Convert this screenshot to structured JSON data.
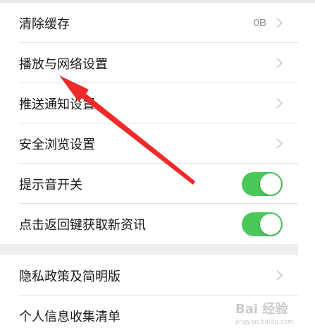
{
  "settings": {
    "rows": [
      {
        "label": "清除缓存",
        "value": "0B"
      },
      {
        "label": "播放与网络设置"
      },
      {
        "label": "推送通知设置"
      },
      {
        "label": "安全浏览设置"
      },
      {
        "label": "提示音开关",
        "toggle": "on"
      },
      {
        "label": "点击返回键获取新资讯",
        "toggle": "on"
      }
    ],
    "rows2": [
      {
        "label": "隐私政策及简明版"
      },
      {
        "label": "个人信息收集清单"
      }
    ]
  },
  "colors": {
    "toggle_on": "#4cc85a",
    "annotation_arrow": "#ee2a2a"
  },
  "icons": {
    "chevron": "chevron-right-icon"
  },
  "watermark": {
    "brand": "Bai 经验",
    "url": "jingyan.baidu.com"
  }
}
